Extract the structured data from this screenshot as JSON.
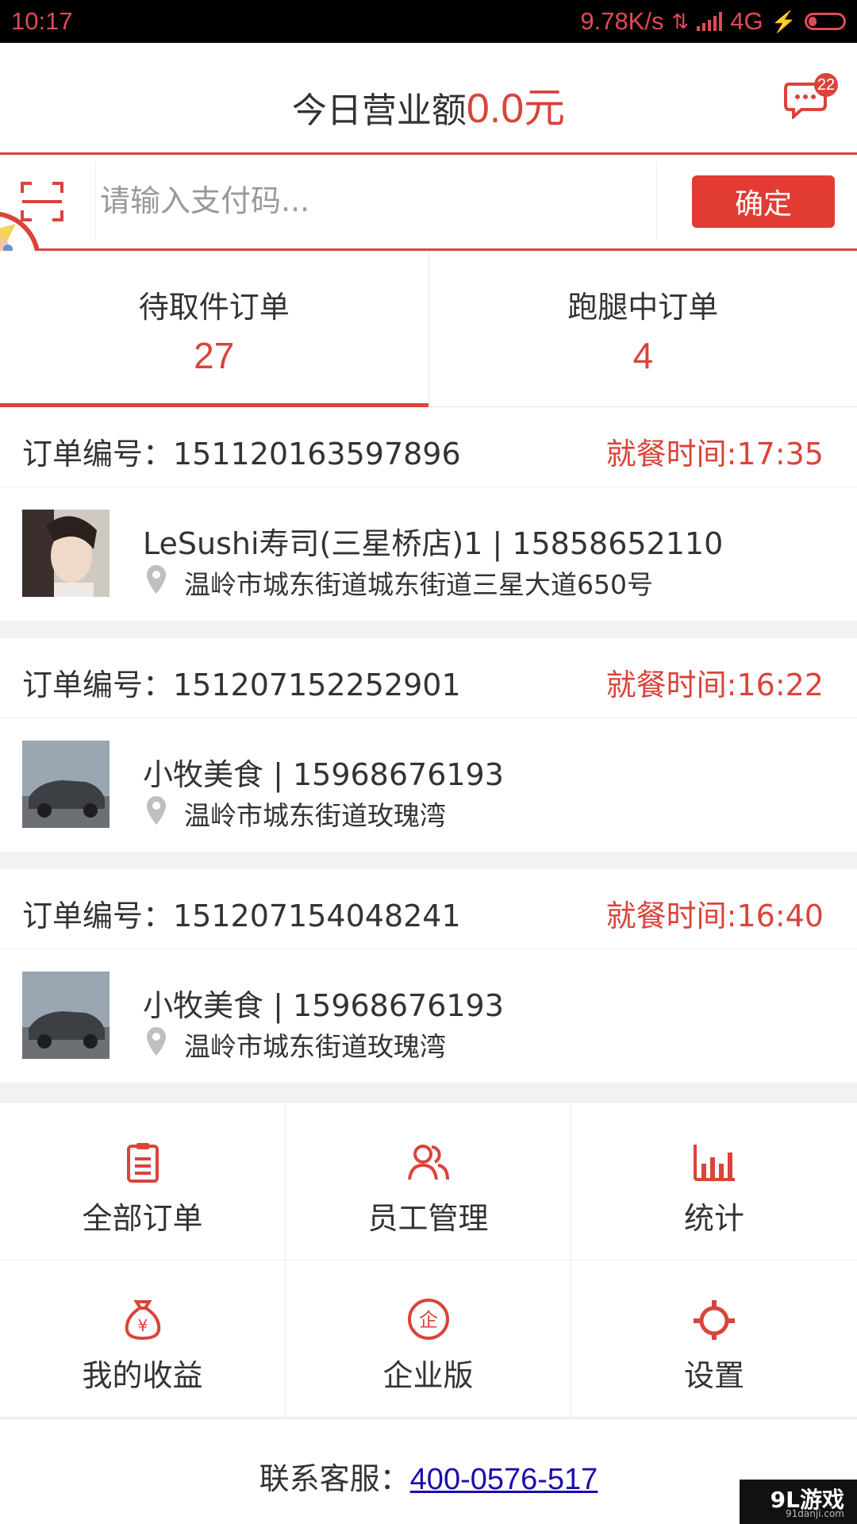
{
  "status_bar": {
    "time": "10:17",
    "network_speed": "9.78K/s",
    "network_type": "4G"
  },
  "header": {
    "title_prefix": "今日营业额",
    "amount": "0.0元",
    "message_count": "22"
  },
  "pay": {
    "placeholder": "请输入支付码...",
    "confirm_label": "确定"
  },
  "tabs": [
    {
      "label": "待取件订单",
      "count": "27",
      "active": true
    },
    {
      "label": "跑腿中订单",
      "count": "4",
      "active": false
    }
  ],
  "orders": [
    {
      "order_no": "订单编号：151120163597896",
      "meal_time": "就餐时间:17:35",
      "name_phone": "LeSushi寿司(三星桥店)1 | 15858652110",
      "address": "温岭市城东街道城东街道三星大道650号",
      "avatar": "woman-portrait"
    },
    {
      "order_no": "订单编号：151207152252901",
      "meal_time": "就餐时间:16:22",
      "name_phone": "小牧美食 | 15968676193",
      "address": "温岭市城东街道玫瑰湾",
      "avatar": "car-photo"
    },
    {
      "order_no": "订单编号：151207154048241",
      "meal_time": "就餐时间:16:40",
      "name_phone": "小牧美食 | 15968676193",
      "address": "温岭市城东街道玫瑰湾",
      "avatar": "car-photo"
    }
  ],
  "menu": [
    {
      "label": "全部订单",
      "icon": "clipboard-icon"
    },
    {
      "label": "员工管理",
      "icon": "users-icon"
    },
    {
      "label": "统计",
      "icon": "bar-chart-icon"
    },
    {
      "label": "我的收益",
      "icon": "money-bag-icon"
    },
    {
      "label": "企业版",
      "icon": "enterprise-icon"
    },
    {
      "label": "设置",
      "icon": "gear-icon"
    }
  ],
  "footer": {
    "label": "联系客服：",
    "phone": "400-0576-517"
  },
  "watermark": {
    "brand": "9L游戏",
    "site": "91danji.com"
  },
  "colors": {
    "accent": "#d9443b",
    "button": "#e23b34",
    "status_text": "#e04a57",
    "link": "#1a0dab"
  }
}
